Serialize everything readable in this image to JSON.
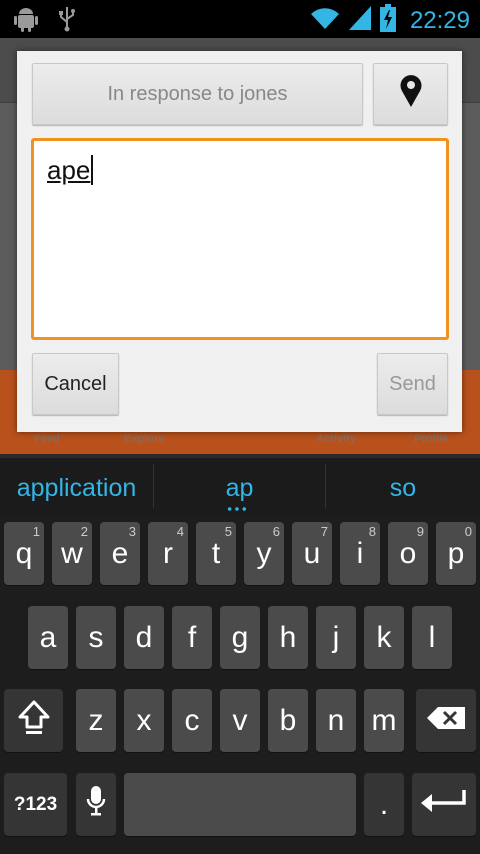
{
  "status_bar": {
    "time": "22:29",
    "left_icons": [
      "android-debug-icon",
      "usb-icon"
    ],
    "right_icons": [
      "wifi-icon",
      "signal-icon",
      "battery-charging-icon"
    ]
  },
  "background_app": {
    "tabs": [
      "Feed",
      "Explore",
      "Activity",
      "Profile"
    ]
  },
  "dialog": {
    "response_button": "In response to jones",
    "location_icon": "map-pin-icon",
    "text_value": "ape",
    "cancel_label": "Cancel",
    "send_label": "Send",
    "accent_color": "#f0931e"
  },
  "keyboard": {
    "suggestions": [
      "application",
      "ap",
      "so"
    ],
    "row1": [
      {
        "label": "q",
        "hint": "1"
      },
      {
        "label": "w",
        "hint": "2"
      },
      {
        "label": "e",
        "hint": "3"
      },
      {
        "label": "r",
        "hint": "4"
      },
      {
        "label": "t",
        "hint": "5"
      },
      {
        "label": "y",
        "hint": "6"
      },
      {
        "label": "u",
        "hint": "7"
      },
      {
        "label": "i",
        "hint": "8"
      },
      {
        "label": "o",
        "hint": "9"
      },
      {
        "label": "p",
        "hint": "0"
      }
    ],
    "row2": [
      "a",
      "s",
      "d",
      "f",
      "g",
      "h",
      "j",
      "k",
      "l"
    ],
    "row3": [
      "z",
      "x",
      "c",
      "v",
      "b",
      "n",
      "m"
    ],
    "symbols_label": "?123",
    "period_label": ".",
    "icons": [
      "shift-icon",
      "backspace-icon",
      "microphone-icon",
      "enter-icon"
    ],
    "accent_color": "#33b5e5"
  }
}
